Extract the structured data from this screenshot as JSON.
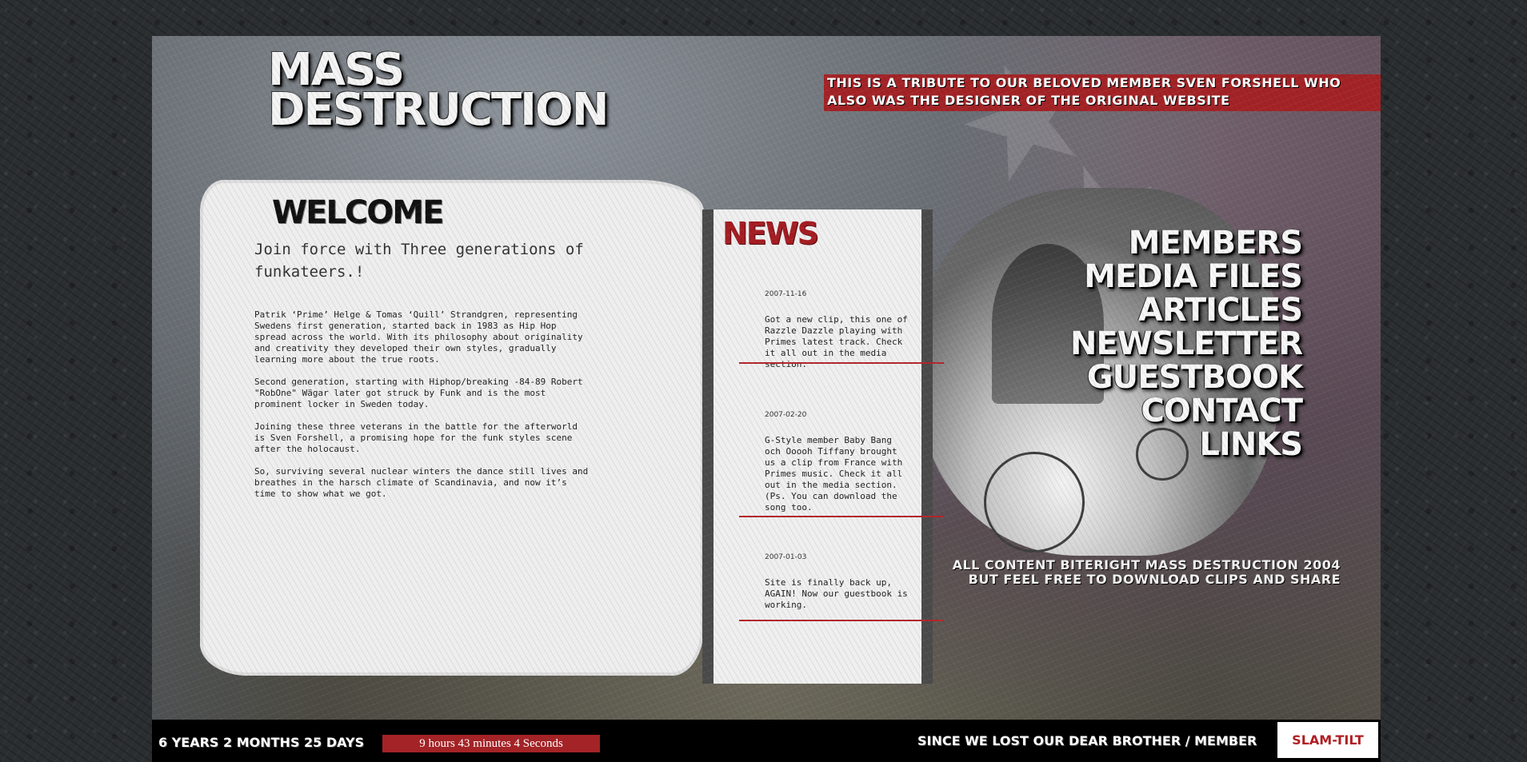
{
  "site": {
    "logo_line1": "MASS",
    "logo_line2": "DESTRUCTION",
    "tribute": "THIS IS A TRIBUTE TO OUR BELOVED MEMBER SVEN FORSHELL WHO ALSO WAS THE DESIGNER OF THE ORIGINAL WEBSITE"
  },
  "welcome": {
    "title": "WELCOME",
    "tagline": "Join force with Three generations of funkateers.!",
    "paragraphs": [
      "Patrik ‘Prime’ Helge & Tomas ‘Quill’ Strandgren, representing Swedens first generation, started back in 1983 as Hip Hop spread across the world. With its philosophy about originality and creativity they developed their own styles, gradually learning more about the true roots.",
      "Second generation, starting with Hiphop/breaking -84-89 Robert \"RobOne\" Wägar later got struck by Funk and is the most prominent locker in Sweden today.",
      "Joining these three veterans in the battle for the afterworld is Sven Forshell, a promising hope for the funk styles scene after the holocaust.",
      "So, surviving several nuclear winters the dance still lives and breathes in the harsch climate of Scandinavia, and now it’s time to show what we got."
    ]
  },
  "news": {
    "title": "NEWS",
    "items": [
      {
        "date": "2007-11-16",
        "text": "Got a new clip, this one of Razzle Dazzle playing with Primes latest track. Check it all out in the media section."
      },
      {
        "date": "2007-02-20",
        "text": "G-Style member Baby Bang och Ooooh Tiffany brought us a clip from France with Primes music. Check it all out in the media section. (Ps. You can download the song too."
      },
      {
        "date": "2007-01-03",
        "text": "Site is finally back up, AGAIN! Now our guestbook is working."
      }
    ]
  },
  "nav": {
    "items": [
      "MEMBERS",
      "MEDIA FILES",
      "ARTICLES",
      "NEWSLETTER",
      "GUESTBOOK",
      "CONTACT",
      "LINKS"
    ]
  },
  "footer": {
    "copyright_line1": "ALL CONTENT BITERIGHT MASS DESTRUCTION 2004",
    "copyright_line2": "BUT FEEL FREE TO DOWNLOAD CLIPS AND SHARE",
    "elapsed_days": "6 YEARS 2 MONTHS 25 DAYS",
    "elapsed_time": "9 hours 43 minutes 4 Seconds",
    "since_text": "SINCE WE LOST OUR DEAR BROTHER / MEMBER",
    "member_name": "SLAM-TILT"
  },
  "colors": {
    "accent_red": "#a32326",
    "panel": "#eeeeee",
    "background": "#2b2e31"
  }
}
